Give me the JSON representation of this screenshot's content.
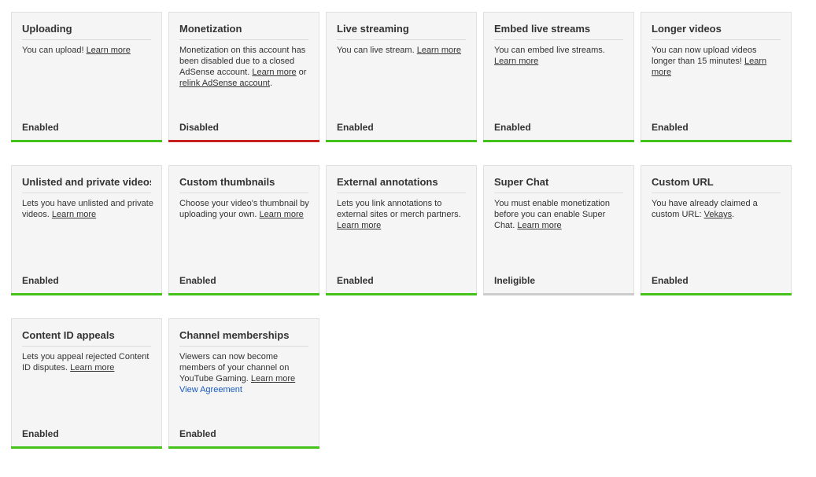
{
  "cards": [
    {
      "title": "Uploading",
      "desc": [
        {
          "text": "You can upload! "
        },
        {
          "text": "Learn more",
          "link": true
        }
      ],
      "status": "Enabled",
      "color": "#44c21c"
    },
    {
      "title": "Monetization",
      "desc": [
        {
          "text": "Monetization on this account has been disabled due to a closed AdSense account. "
        },
        {
          "text": "Learn more",
          "link": true
        },
        {
          "text": " or "
        },
        {
          "text": "relink AdSense account",
          "link": true
        },
        {
          "text": "."
        }
      ],
      "status": "Disabled",
      "color": "#c8201e"
    },
    {
      "title": "Live streaming",
      "desc": [
        {
          "text": "You can live stream. "
        },
        {
          "text": "Learn more",
          "link": true
        }
      ],
      "status": "Enabled",
      "color": "#44c21c"
    },
    {
      "title": "Embed live streams",
      "desc": [
        {
          "text": "You can embed live streams. "
        },
        {
          "text": "Learn more",
          "link": true
        }
      ],
      "status": "Enabled",
      "color": "#44c21c"
    },
    {
      "title": "Longer videos",
      "desc": [
        {
          "text": "You can now upload videos longer than 15 minutes! "
        },
        {
          "text": "Learn more",
          "link": true
        }
      ],
      "status": "Enabled",
      "color": "#44c21c"
    },
    {
      "title": "Unlisted and private videos",
      "desc": [
        {
          "text": "Lets you have unlisted and private videos. "
        },
        {
          "text": "Learn more",
          "link": true
        }
      ],
      "status": "Enabled",
      "color": "#44c21c"
    },
    {
      "title": "Custom thumbnails",
      "desc": [
        {
          "text": "Choose your video's thumbnail by uploading your own. "
        },
        {
          "text": "Learn more",
          "link": true
        }
      ],
      "status": "Enabled",
      "color": "#44c21c"
    },
    {
      "title": "External annotations",
      "desc": [
        {
          "text": "Lets you link annotations to external sites or merch partners. "
        },
        {
          "text": "Learn more",
          "link": true
        }
      ],
      "status": "Enabled",
      "color": "#44c21c"
    },
    {
      "title": "Super Chat",
      "desc": [
        {
          "text": "You must enable monetization before you can enable Super Chat. "
        },
        {
          "text": "Learn more",
          "link": true
        }
      ],
      "status": "Ineligible",
      "color": "#cccccc"
    },
    {
      "title": "Custom URL",
      "desc": [
        {
          "text": "You have already claimed a custom URL: "
        },
        {
          "text": "Vekays",
          "link": true
        },
        {
          "text": "."
        }
      ],
      "status": "Enabled",
      "color": "#44c21c"
    },
    {
      "title": "Content ID appeals",
      "desc": [
        {
          "text": "Lets you appeal rejected Content ID disputes. "
        },
        {
          "text": "Learn more",
          "link": true
        }
      ],
      "status": "Enabled",
      "color": "#44c21c"
    },
    {
      "title": "Channel memberships",
      "desc": [
        {
          "text": "Viewers can now become members of your channel on YouTube Gaming. "
        },
        {
          "text": "Learn more",
          "link": true
        },
        {
          "break": true
        },
        {
          "text": "View Agreement",
          "link": true,
          "blue": true
        }
      ],
      "status": "Enabled",
      "color": "#44c21c"
    }
  ]
}
